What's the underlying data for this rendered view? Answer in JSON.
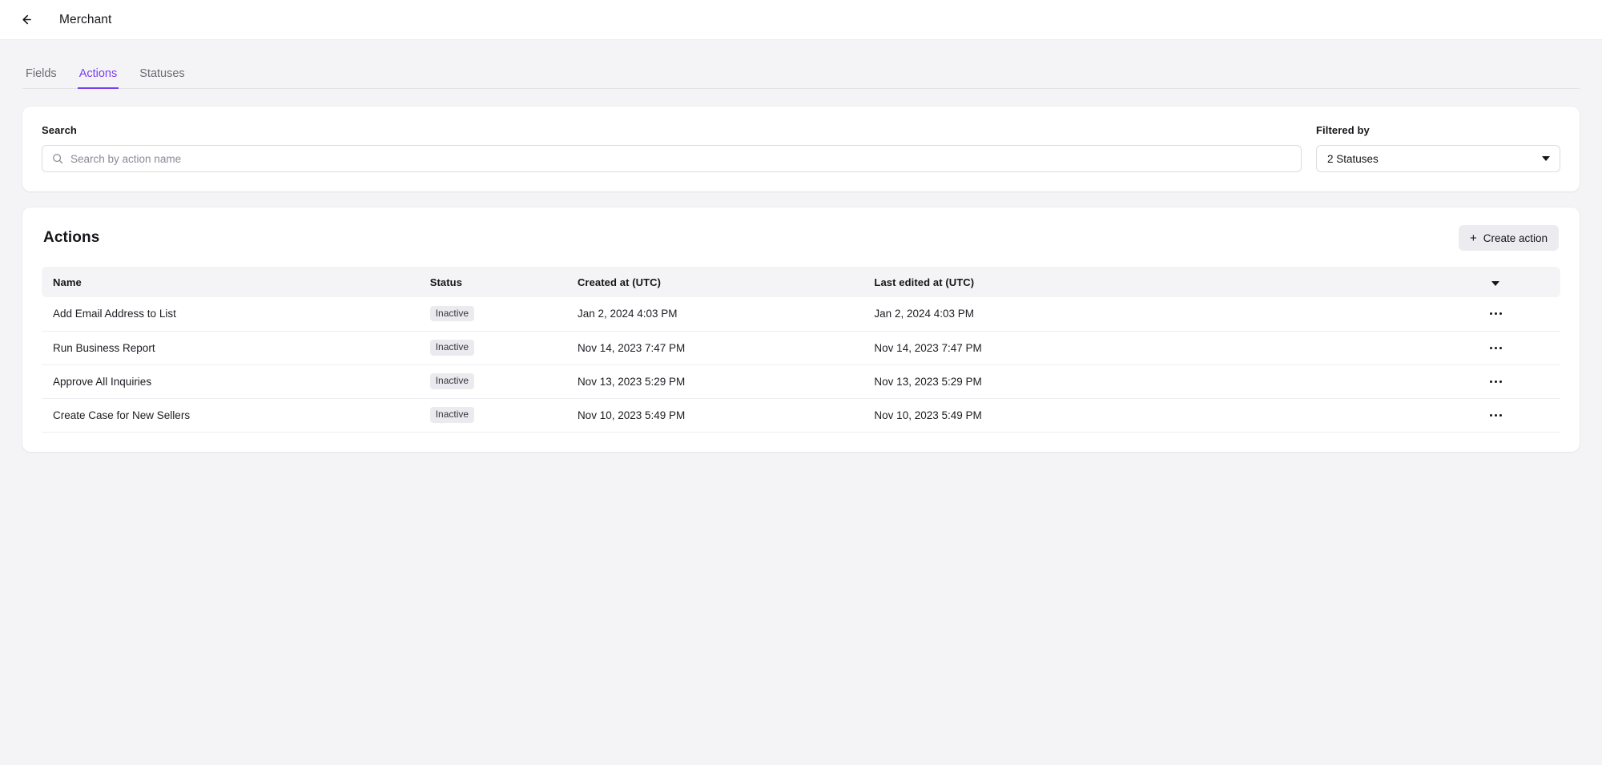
{
  "topbar": {
    "back_icon": "arrow-left-icon",
    "title": "Merchant"
  },
  "tabs": [
    {
      "label": "Fields",
      "active": false
    },
    {
      "label": "Actions",
      "active": true
    },
    {
      "label": "Statuses",
      "active": false
    }
  ],
  "search_panel": {
    "search_label": "Search",
    "search_placeholder": "Search by action name",
    "search_value": "",
    "search_icon": "search-icon",
    "filter_label": "Filtered by",
    "filter_value": "2 Statuses",
    "filter_caret_icon": "chevron-down-icon"
  },
  "actions_panel": {
    "title": "Actions",
    "create_button_label": "Create action",
    "create_button_icon": "plus-icon",
    "columns": [
      "Name",
      "Status",
      "Created at (UTC)",
      "Last edited at (UTC)"
    ],
    "sort_icon": "chevron-down-icon",
    "row_menu_icon": "ellipsis-icon",
    "rows": [
      {
        "name": "Add Email Address to List",
        "status": "Inactive",
        "created_at": "Jan 2, 2024 4:03 PM",
        "last_edited_at": "Jan 2, 2024 4:03 PM"
      },
      {
        "name": "Run Business Report",
        "status": "Inactive",
        "created_at": "Nov 14, 2023 7:47 PM",
        "last_edited_at": "Nov 14, 2023 7:47 PM"
      },
      {
        "name": "Approve All Inquiries",
        "status": "Inactive",
        "created_at": "Nov 13, 2023 5:29 PM",
        "last_edited_at": "Nov 13, 2023 5:29 PM"
      },
      {
        "name": "Create Case for New Sellers",
        "status": "Inactive",
        "created_at": "Nov 10, 2023 5:49 PM",
        "last_edited_at": "Nov 10, 2023 5:49 PM"
      }
    ]
  },
  "colors": {
    "accent": "#7b3ff2",
    "page_background": "#f4f4f6",
    "card_background": "#ffffff",
    "badge_background": "#ebebef",
    "button_background": "#ececf0",
    "text_primary": "#16161a",
    "text_muted": "#6b6b76"
  }
}
